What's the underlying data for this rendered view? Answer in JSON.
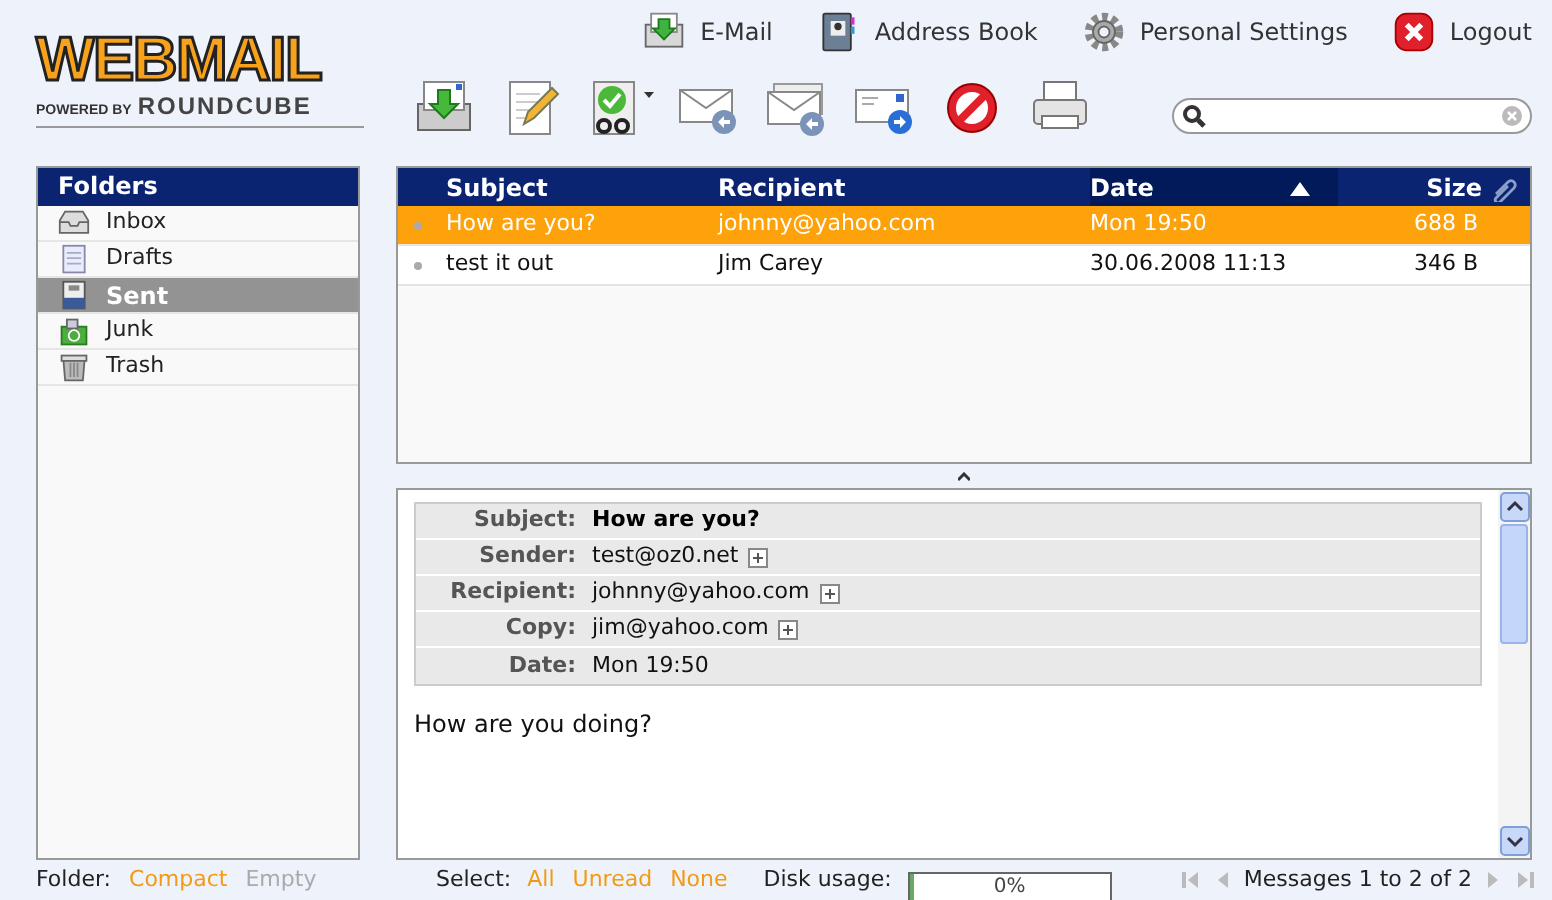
{
  "logo": {
    "title": "WEBMAIL",
    "prefix": "POWERED BY",
    "brand": "ROUNDCUBE"
  },
  "top_links": [
    {
      "label": "E-Mail",
      "kind": "mail"
    },
    {
      "label": "Address Book",
      "kind": "book"
    },
    {
      "label": "Personal Settings",
      "kind": "gear"
    },
    {
      "label": "Logout",
      "kind": "logout"
    }
  ],
  "toolbar": [
    {
      "kind": "check-mail",
      "menu": false
    },
    {
      "kind": "compose",
      "menu": false
    },
    {
      "kind": "mark",
      "menu": true
    },
    {
      "kind": "reply",
      "menu": false
    },
    {
      "kind": "reply-all",
      "menu": false
    },
    {
      "kind": "forward",
      "menu": false
    },
    {
      "kind": "delete",
      "menu": false
    },
    {
      "kind": "print",
      "menu": false
    }
  ],
  "folders": {
    "title": "Folders",
    "items": [
      {
        "label": "Inbox",
        "kind": "inbox",
        "selected": false
      },
      {
        "label": "Drafts",
        "kind": "drafts",
        "selected": false
      },
      {
        "label": "Sent",
        "kind": "sent",
        "selected": true
      },
      {
        "label": "Junk",
        "kind": "junk",
        "selected": false
      },
      {
        "label": "Trash",
        "kind": "trash",
        "selected": false
      }
    ]
  },
  "message_list": {
    "columns": [
      {
        "label": "Subject",
        "sorted": false
      },
      {
        "label": "Recipient",
        "sorted": false
      },
      {
        "label": "Date",
        "sorted": true
      },
      {
        "label": "Size",
        "sorted": false
      }
    ],
    "rows": [
      {
        "subject": "How are you?",
        "recipient": "johnny@yahoo.com",
        "date": "Mon 19:50",
        "size": "688 B",
        "selected": true
      },
      {
        "subject": "test it out",
        "recipient": "Jim Carey",
        "date": "30.06.2008 11:13",
        "size": "346 B",
        "selected": false
      }
    ]
  },
  "preview": {
    "headers": [
      {
        "label": "Subject:",
        "value": "How are you?",
        "kind": "subject",
        "expandable": false
      },
      {
        "label": "Sender:",
        "value": "test@oz0.net",
        "kind": "address",
        "expandable": true
      },
      {
        "label": "Recipient:",
        "value": "johnny@yahoo.com",
        "kind": "address",
        "expandable": true
      },
      {
        "label": "Copy:",
        "value": "jim@yahoo.com",
        "kind": "address",
        "expandable": true
      },
      {
        "label": "Date:",
        "value": "Mon 19:50",
        "kind": "date",
        "expandable": false
      }
    ],
    "body": "How are you doing?"
  },
  "footer": {
    "folder_label": "Folder:",
    "folder_actions": [
      {
        "label": "Compact",
        "disabled": false
      },
      {
        "label": "Empty",
        "disabled": true
      }
    ],
    "select_label": "Select:",
    "select_actions": [
      {
        "label": "All",
        "disabled": false
      },
      {
        "label": "Unread",
        "disabled": false
      },
      {
        "label": "None",
        "disabled": false
      }
    ],
    "disk_usage": {
      "label": "Disk usage:",
      "reading": "0%",
      "level": 0
    },
    "pager": {
      "first_disabled": true,
      "previous_disabled": true,
      "text": "Messages 1 to 2 of 2",
      "next_disabled": true,
      "last_disabled": true
    }
  }
}
